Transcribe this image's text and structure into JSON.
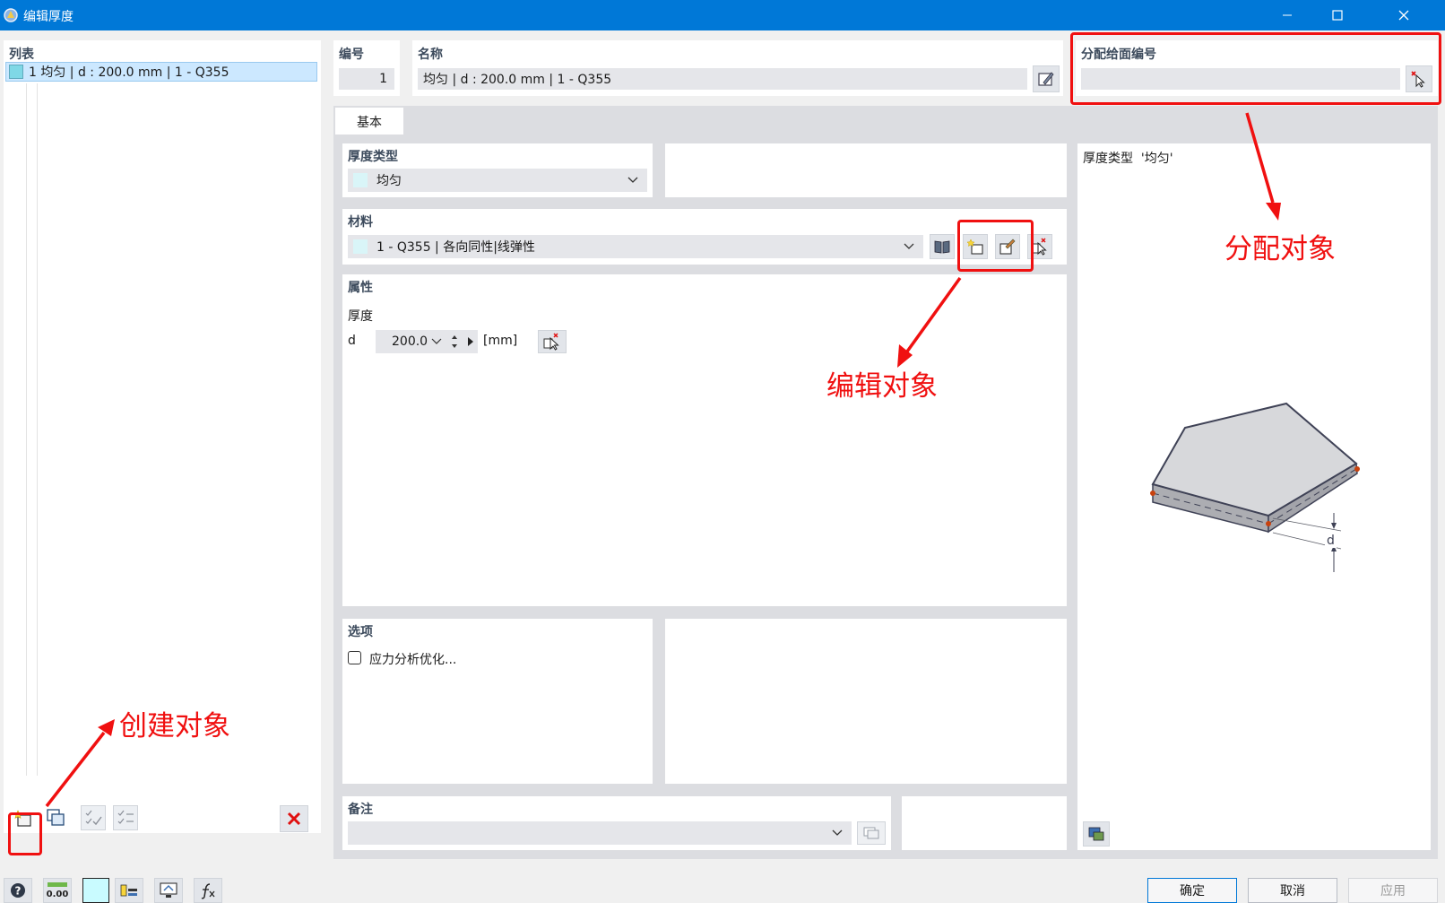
{
  "window": {
    "title": "编辑厚度"
  },
  "list": {
    "header": "列表",
    "items": [
      {
        "label": "1 均匀 | d : 200.0 mm | 1 - Q355"
      }
    ]
  },
  "number": {
    "label": "编号",
    "value": "1"
  },
  "name": {
    "label": "名称",
    "value": "均匀 | d : 200.0 mm | 1 - Q355"
  },
  "assign": {
    "label": "分配给面编号",
    "value": ""
  },
  "tabs": [
    {
      "label": "基本"
    }
  ],
  "thickness_type": {
    "label": "厚度类型",
    "value": "均匀"
  },
  "material": {
    "label": "材料",
    "value": "1 - Q355 | 各向同性|线弹性"
  },
  "properties": {
    "label": "属性",
    "thickness_label": "厚度",
    "symbol": "d",
    "value": "200.0",
    "unit": "[mm]"
  },
  "options": {
    "label": "选项",
    "stress_optimization": "应力分析优化..."
  },
  "comment": {
    "label": "备注",
    "value": ""
  },
  "preview": {
    "caption": "厚度类型  '均匀'",
    "dim_label": "d"
  },
  "footer": {
    "ok": "确定",
    "cancel": "取消",
    "apply": "应用",
    "zero_label": "0.00"
  },
  "annotations": {
    "assign": "分配对象",
    "edit": "编辑对象",
    "create": "创建对象"
  },
  "colors": {
    "titlebar": "#0078d7",
    "annotation": "#f01010",
    "selection": "#cce8ff"
  }
}
